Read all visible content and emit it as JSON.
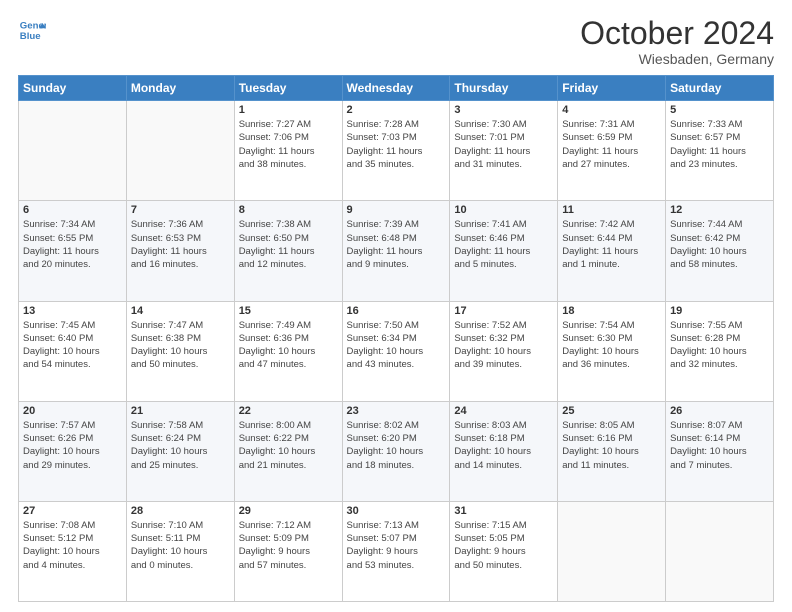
{
  "header": {
    "logo_line1": "General",
    "logo_line2": "Blue",
    "month": "October 2024",
    "location": "Wiesbaden, Germany"
  },
  "days_of_week": [
    "Sunday",
    "Monday",
    "Tuesday",
    "Wednesday",
    "Thursday",
    "Friday",
    "Saturday"
  ],
  "weeks": [
    [
      {
        "day": "",
        "info": ""
      },
      {
        "day": "",
        "info": ""
      },
      {
        "day": "1",
        "info": "Sunrise: 7:27 AM\nSunset: 7:06 PM\nDaylight: 11 hours\nand 38 minutes."
      },
      {
        "day": "2",
        "info": "Sunrise: 7:28 AM\nSunset: 7:03 PM\nDaylight: 11 hours\nand 35 minutes."
      },
      {
        "day": "3",
        "info": "Sunrise: 7:30 AM\nSunset: 7:01 PM\nDaylight: 11 hours\nand 31 minutes."
      },
      {
        "day": "4",
        "info": "Sunrise: 7:31 AM\nSunset: 6:59 PM\nDaylight: 11 hours\nand 27 minutes."
      },
      {
        "day": "5",
        "info": "Sunrise: 7:33 AM\nSunset: 6:57 PM\nDaylight: 11 hours\nand 23 minutes."
      }
    ],
    [
      {
        "day": "6",
        "info": "Sunrise: 7:34 AM\nSunset: 6:55 PM\nDaylight: 11 hours\nand 20 minutes."
      },
      {
        "day": "7",
        "info": "Sunrise: 7:36 AM\nSunset: 6:53 PM\nDaylight: 11 hours\nand 16 minutes."
      },
      {
        "day": "8",
        "info": "Sunrise: 7:38 AM\nSunset: 6:50 PM\nDaylight: 11 hours\nand 12 minutes."
      },
      {
        "day": "9",
        "info": "Sunrise: 7:39 AM\nSunset: 6:48 PM\nDaylight: 11 hours\nand 9 minutes."
      },
      {
        "day": "10",
        "info": "Sunrise: 7:41 AM\nSunset: 6:46 PM\nDaylight: 11 hours\nand 5 minutes."
      },
      {
        "day": "11",
        "info": "Sunrise: 7:42 AM\nSunset: 6:44 PM\nDaylight: 11 hours\nand 1 minute."
      },
      {
        "day": "12",
        "info": "Sunrise: 7:44 AM\nSunset: 6:42 PM\nDaylight: 10 hours\nand 58 minutes."
      }
    ],
    [
      {
        "day": "13",
        "info": "Sunrise: 7:45 AM\nSunset: 6:40 PM\nDaylight: 10 hours\nand 54 minutes."
      },
      {
        "day": "14",
        "info": "Sunrise: 7:47 AM\nSunset: 6:38 PM\nDaylight: 10 hours\nand 50 minutes."
      },
      {
        "day": "15",
        "info": "Sunrise: 7:49 AM\nSunset: 6:36 PM\nDaylight: 10 hours\nand 47 minutes."
      },
      {
        "day": "16",
        "info": "Sunrise: 7:50 AM\nSunset: 6:34 PM\nDaylight: 10 hours\nand 43 minutes."
      },
      {
        "day": "17",
        "info": "Sunrise: 7:52 AM\nSunset: 6:32 PM\nDaylight: 10 hours\nand 39 minutes."
      },
      {
        "day": "18",
        "info": "Sunrise: 7:54 AM\nSunset: 6:30 PM\nDaylight: 10 hours\nand 36 minutes."
      },
      {
        "day": "19",
        "info": "Sunrise: 7:55 AM\nSunset: 6:28 PM\nDaylight: 10 hours\nand 32 minutes."
      }
    ],
    [
      {
        "day": "20",
        "info": "Sunrise: 7:57 AM\nSunset: 6:26 PM\nDaylight: 10 hours\nand 29 minutes."
      },
      {
        "day": "21",
        "info": "Sunrise: 7:58 AM\nSunset: 6:24 PM\nDaylight: 10 hours\nand 25 minutes."
      },
      {
        "day": "22",
        "info": "Sunrise: 8:00 AM\nSunset: 6:22 PM\nDaylight: 10 hours\nand 21 minutes."
      },
      {
        "day": "23",
        "info": "Sunrise: 8:02 AM\nSunset: 6:20 PM\nDaylight: 10 hours\nand 18 minutes."
      },
      {
        "day": "24",
        "info": "Sunrise: 8:03 AM\nSunset: 6:18 PM\nDaylight: 10 hours\nand 14 minutes."
      },
      {
        "day": "25",
        "info": "Sunrise: 8:05 AM\nSunset: 6:16 PM\nDaylight: 10 hours\nand 11 minutes."
      },
      {
        "day": "26",
        "info": "Sunrise: 8:07 AM\nSunset: 6:14 PM\nDaylight: 10 hours\nand 7 minutes."
      }
    ],
    [
      {
        "day": "27",
        "info": "Sunrise: 7:08 AM\nSunset: 5:12 PM\nDaylight: 10 hours\nand 4 minutes."
      },
      {
        "day": "28",
        "info": "Sunrise: 7:10 AM\nSunset: 5:11 PM\nDaylight: 10 hours\nand 0 minutes."
      },
      {
        "day": "29",
        "info": "Sunrise: 7:12 AM\nSunset: 5:09 PM\nDaylight: 9 hours\nand 57 minutes."
      },
      {
        "day": "30",
        "info": "Sunrise: 7:13 AM\nSunset: 5:07 PM\nDaylight: 9 hours\nand 53 minutes."
      },
      {
        "day": "31",
        "info": "Sunrise: 7:15 AM\nSunset: 5:05 PM\nDaylight: 9 hours\nand 50 minutes."
      },
      {
        "day": "",
        "info": ""
      },
      {
        "day": "",
        "info": ""
      }
    ]
  ]
}
